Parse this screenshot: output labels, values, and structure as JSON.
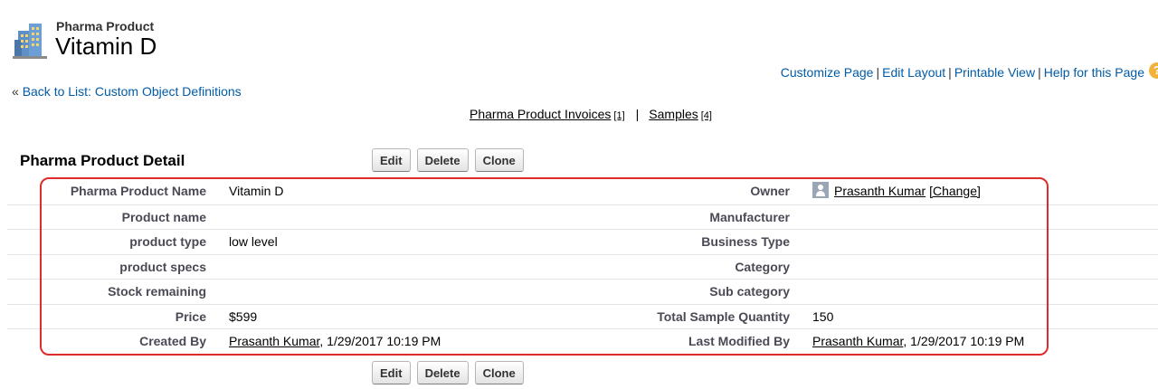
{
  "header": {
    "object_type": "Pharma Product",
    "title": "Vitamin D"
  },
  "top_links": [
    {
      "label": "Customize Page"
    },
    {
      "label": "Edit Layout"
    },
    {
      "label": "Printable View"
    },
    {
      "label": "Help for this Page"
    }
  ],
  "back_link": {
    "prefix": "«",
    "label": "Back to List: Custom Object Definitions"
  },
  "related_lists": [
    {
      "label": "Pharma Product Invoices",
      "count": "[1]"
    },
    {
      "label": "Samples",
      "count": "[4]"
    }
  ],
  "detail": {
    "section_title": "Pharma Product Detail",
    "buttons": {
      "edit": "Edit",
      "delete": "Delete",
      "clone": "Clone"
    },
    "rows": [
      {
        "label1": "Pharma Product Name",
        "value1": "Vitamin D",
        "label2": "Owner",
        "value2_link": "Prasanth Kumar",
        "value2_extra": "[Change]"
      },
      {
        "label1": "Product name",
        "value1": "",
        "label2": "Manufacturer",
        "value2": ""
      },
      {
        "label1": "product type",
        "value1": "low level",
        "label2": "Business Type",
        "value2": ""
      },
      {
        "label1": "product specs",
        "value1": "",
        "label2": "Category",
        "value2": ""
      },
      {
        "label1": "Stock remaining",
        "value1": "",
        "label2": "Sub category",
        "value2": ""
      },
      {
        "label1": "Price",
        "value1": "$599",
        "label2": "Total Sample Quantity",
        "value2": "150"
      },
      {
        "label1": "Created By",
        "value1_link": "Prasanth Kumar",
        "value1_rest": ", 1/29/2017 10:19 PM",
        "label2": "Last Modified By",
        "value2_link": "Prasanth Kumar",
        "value2_rest": ", 1/29/2017 10:19 PM"
      }
    ]
  },
  "icons": {
    "object": "building-icon",
    "help": "help-icon",
    "owner": "user-avatar-icon"
  },
  "colors": {
    "link": "#015ba7",
    "highlight": "#e02b2b"
  }
}
